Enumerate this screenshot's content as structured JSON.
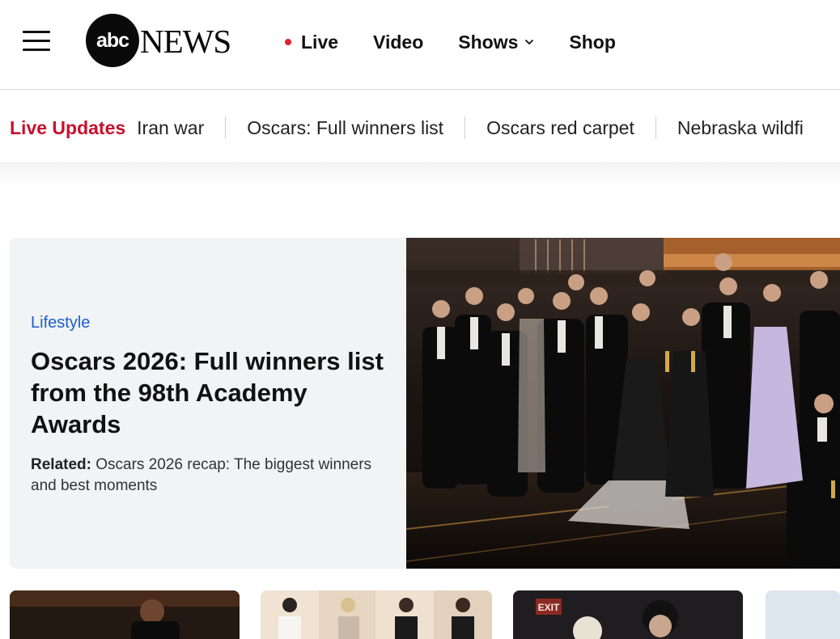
{
  "nav": {
    "logo_mark": "abc",
    "logo_word": "NEWS",
    "links": [
      {
        "label": "Live",
        "has_dot": true
      },
      {
        "label": "Video"
      },
      {
        "label": "Shows",
        "has_dropdown": true
      },
      {
        "label": "Shop"
      }
    ],
    "icons": {
      "menu": "hamburger-icon",
      "chevron": "chevron-down-icon",
      "live": "live-dot-icon"
    }
  },
  "ticker": {
    "label": "Live Updates",
    "items": [
      "Iran war",
      "Oscars: Full winners list",
      "Oscars red carpet",
      "Nebraska wildfi"
    ]
  },
  "hero": {
    "category": "Lifestyle",
    "headline": "Oscars 2026: Full winners list from the 98th Academy Awards",
    "related_prefix": "Related:",
    "related_text": "Oscars 2026 recap: The biggest winners and best moments"
  },
  "colors": {
    "accent_red": "#c8102e",
    "live_dot": "#e0242c",
    "category_blue": "#1a5fd1",
    "hero_bg": "#f2f3f5"
  },
  "cards": {
    "card_3_sign": "EXIT"
  }
}
